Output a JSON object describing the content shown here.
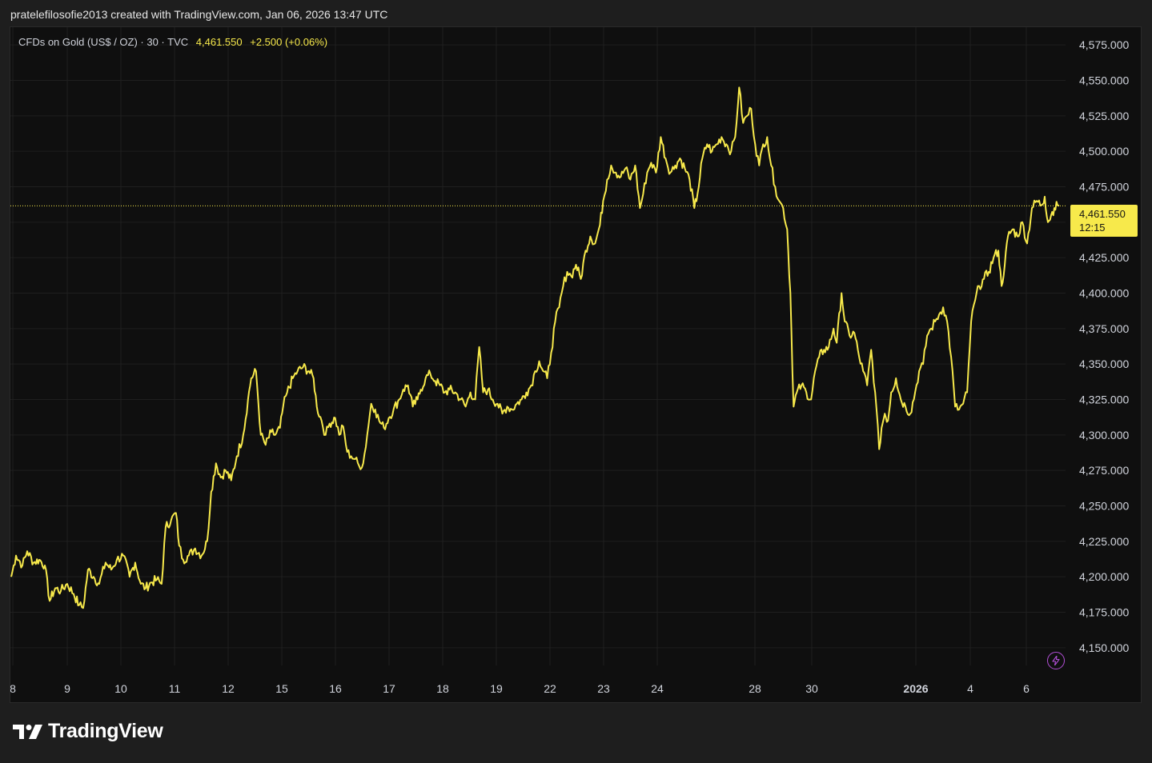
{
  "header": {
    "text": "pratelefilosofie2013 created with TradingView.com, Jan 06, 2026 13:47 UTC"
  },
  "legend": {
    "symbol": "CFDs on Gold (US$ / OZ) · 30 · TVC",
    "last": "4,461.550",
    "change": "+2.500 (+0.06%)"
  },
  "price_tag": {
    "price": "4,461.550",
    "countdown": "12:15"
  },
  "footer": {
    "logo_text": "TradingView"
  },
  "icons": {
    "realtime": "lightning-icon",
    "logo": "tradingview-logo-icon"
  },
  "colors": {
    "line": "#f7e94b",
    "background": "#0f0f0f",
    "grid": "#1f1f1f",
    "accent_purple": "#b24fd6"
  },
  "chart_data": {
    "type": "line",
    "title": "CFDs on Gold (US$ / OZ) · 30 · TVC",
    "ylim": [
      4137.5,
      4587.5
    ],
    "y_ticks": [
      4575,
      4550,
      4525,
      4500,
      4475,
      4450,
      4425,
      4400,
      4375,
      4350,
      4325,
      4300,
      4275,
      4250,
      4225,
      4200,
      4175,
      4150
    ],
    "y_tick_labels": [
      "4,575.000",
      "4,550.000",
      "4,525.000",
      "4,500.000",
      "4,475.000",
      "4,450.000",
      "4,425.000",
      "4,400.000",
      "4,375.000",
      "4,350.000",
      "4,325.000",
      "4,300.000",
      "4,275.000",
      "4,250.000",
      "4,225.000",
      "4,200.000",
      "4,175.000",
      "4,150.000"
    ],
    "x_tick_labels": [
      "8",
      "9",
      "10",
      "11",
      "12",
      "15",
      "16",
      "17",
      "18",
      "19",
      "22",
      "23",
      "24",
      "28",
      "30",
      "2026",
      "4",
      "6"
    ],
    "x_tick_bold": [
      "2026"
    ],
    "last_value": 4461.55,
    "grid": true,
    "series": [
      {
        "x_index_range": [
          0,
          1310
        ],
        "values": [
          [
            0,
            4200
          ],
          [
            6,
            4215
          ],
          [
            14,
            4208
          ],
          [
            20,
            4218
          ],
          [
            28,
            4210
          ],
          [
            35,
            4212
          ],
          [
            42,
            4208
          ],
          [
            48,
            4183
          ],
          [
            55,
            4192
          ],
          [
            62,
            4190
          ],
          [
            70,
            4195
          ],
          [
            78,
            4188
          ],
          [
            85,
            4180
          ],
          [
            90,
            4178
          ],
          [
            96,
            4205
          ],
          [
            103,
            4200
          ],
          [
            110,
            4195
          ],
          [
            118,
            4210
          ],
          [
            125,
            4205
          ],
          [
            132,
            4212
          ],
          [
            140,
            4215
          ],
          [
            148,
            4200
          ],
          [
            155,
            4210
          ],
          [
            162,
            4195
          ],
          [
            168,
            4192
          ],
          [
            175,
            4196
          ],
          [
            182,
            4198
          ],
          [
            188,
            4195
          ],
          [
            193,
            4235
          ],
          [
            200,
            4240
          ],
          [
            206,
            4245
          ],
          [
            210,
            4222
          ],
          [
            215,
            4212
          ],
          [
            222,
            4215
          ],
          [
            230,
            4220
          ],
          [
            238,
            4215
          ],
          [
            245,
            4225
          ],
          [
            250,
            4260
          ],
          [
            256,
            4280
          ],
          [
            262,
            4270
          ],
          [
            268,
            4275
          ],
          [
            275,
            4268
          ],
          [
            282,
            4285
          ],
          [
            290,
            4300
          ],
          [
            296,
            4325
          ],
          [
            300,
            4340
          ],
          [
            306,
            4345
          ],
          [
            312,
            4300
          ],
          [
            318,
            4293
          ],
          [
            325,
            4302
          ],
          [
            330,
            4300
          ],
          [
            336,
            4305
          ],
          [
            340,
            4320
          ],
          [
            345,
            4330
          ],
          [
            352,
            4340
          ],
          [
            358,
            4345
          ],
          [
            365,
            4348
          ],
          [
            372,
            4345
          ],
          [
            378,
            4340
          ],
          [
            382,
            4320
          ],
          [
            388,
            4310
          ],
          [
            393,
            4300
          ],
          [
            398,
            4308
          ],
          [
            405,
            4312
          ],
          [
            410,
            4300
          ],
          [
            415,
            4306
          ],
          [
            420,
            4288
          ],
          [
            425,
            4285
          ],
          [
            430,
            4283
          ],
          [
            435,
            4278
          ],
          [
            440,
            4280
          ],
          [
            445,
            4300
          ],
          [
            450,
            4322
          ],
          [
            455,
            4318
          ],
          [
            460,
            4310
          ],
          [
            466,
            4305
          ],
          [
            472,
            4312
          ],
          [
            478,
            4318
          ],
          [
            485,
            4325
          ],
          [
            490,
            4332
          ],
          [
            496,
            4335
          ],
          [
            502,
            4320
          ],
          [
            508,
            4325
          ],
          [
            512,
            4332
          ],
          [
            518,
            4340
          ],
          [
            524,
            4343
          ],
          [
            530,
            4338
          ],
          [
            536,
            4335
          ],
          [
            542,
            4330
          ],
          [
            548,
            4332
          ],
          [
            555,
            4330
          ],
          [
            562,
            4325
          ],
          [
            568,
            4320
          ],
          [
            574,
            4330
          ],
          [
            580,
            4325
          ],
          [
            585,
            4362
          ],
          [
            590,
            4330
          ],
          [
            596,
            4332
          ],
          [
            602,
            4325
          ],
          [
            608,
            4322
          ],
          [
            614,
            4315
          ],
          [
            620,
            4320
          ],
          [
            626,
            4318
          ],
          [
            632,
            4322
          ],
          [
            638,
            4325
          ],
          [
            644,
            4330
          ],
          [
            650,
            4335
          ],
          [
            655,
            4345
          ],
          [
            660,
            4352
          ],
          [
            665,
            4345
          ],
          [
            670,
            4340
          ],
          [
            675,
            4358
          ],
          [
            680,
            4380
          ],
          [
            685,
            4390
          ],
          [
            690,
            4405
          ],
          [
            695,
            4415
          ],
          [
            700,
            4412
          ],
          [
            706,
            4420
          ],
          [
            712,
            4410
          ],
          [
            718,
            4430
          ],
          [
            724,
            4440
          ],
          [
            730,
            4435
          ],
          [
            736,
            4448
          ],
          [
            740,
            4465
          ],
          [
            745,
            4480
          ],
          [
            750,
            4490
          ],
          [
            756,
            4485
          ],
          [
            762,
            4482
          ],
          [
            768,
            4488
          ],
          [
            774,
            4480
          ],
          [
            780,
            4490
          ],
          [
            786,
            4460
          ],
          [
            790,
            4470
          ],
          [
            795,
            4485
          ],
          [
            800,
            4492
          ],
          [
            806,
            4485
          ],
          [
            812,
            4510
          ],
          [
            818,
            4495
          ],
          [
            824,
            4485
          ],
          [
            830,
            4490
          ],
          [
            836,
            4495
          ],
          [
            842,
            4488
          ],
          [
            848,
            4480
          ],
          [
            854,
            4460
          ],
          [
            858,
            4470
          ],
          [
            864,
            4495
          ],
          [
            870,
            4505
          ],
          [
            876,
            4500
          ],
          [
            882,
            4505
          ],
          [
            888,
            4510
          ],
          [
            894,
            4505
          ],
          [
            900,
            4500
          ],
          [
            905,
            4510
          ],
          [
            910,
            4545
          ],
          [
            915,
            4520
          ],
          [
            920,
            4525
          ],
          [
            925,
            4530
          ],
          [
            930,
            4505
          ],
          [
            935,
            4490
          ],
          [
            940,
            4505
          ],
          [
            945,
            4510
          ],
          [
            950,
            4490
          ],
          [
            955,
            4475
          ],
          [
            960,
            4465
          ],
          [
            965,
            4460
          ],
          [
            970,
            4445
          ],
          [
            974,
            4400
          ],
          [
            978,
            4320
          ],
          [
            982,
            4330
          ],
          [
            988,
            4335
          ],
          [
            994,
            4330
          ],
          [
            1000,
            4325
          ],
          [
            1005,
            4345
          ],
          [
            1010,
            4355
          ],
          [
            1016,
            4360
          ],
          [
            1022,
            4362
          ],
          [
            1028,
            4375
          ],
          [
            1032,
            4365
          ],
          [
            1038,
            4400
          ],
          [
            1042,
            4380
          ],
          [
            1048,
            4370
          ],
          [
            1054,
            4372
          ],
          [
            1060,
            4355
          ],
          [
            1065,
            4345
          ],
          [
            1070,
            4335
          ],
          [
            1075,
            4360
          ],
          [
            1080,
            4330
          ],
          [
            1085,
            4290
          ],
          [
            1088,
            4305
          ],
          [
            1092,
            4315
          ],
          [
            1096,
            4310
          ],
          [
            1100,
            4330
          ],
          [
            1106,
            4340
          ],
          [
            1112,
            4325
          ],
          [
            1118,
            4320
          ],
          [
            1124,
            4315
          ],
          [
            1130,
            4330
          ],
          [
            1135,
            4345
          ],
          [
            1140,
            4350
          ],
          [
            1145,
            4370
          ],
          [
            1150,
            4375
          ],
          [
            1155,
            4380
          ],
          [
            1160,
            4385
          ],
          [
            1165,
            4390
          ],
          [
            1170,
            4380
          ],
          [
            1175,
            4355
          ],
          [
            1180,
            4320
          ],
          [
            1185,
            4318
          ],
          [
            1190,
            4322
          ],
          [
            1195,
            4330
          ],
          [
            1200,
            4380
          ],
          [
            1205,
            4395
          ],
          [
            1210,
            4405
          ],
          [
            1216,
            4410
          ],
          [
            1222,
            4415
          ],
          [
            1228,
            4425
          ],
          [
            1234,
            4430
          ],
          [
            1238,
            4405
          ],
          [
            1242,
            4420
          ],
          [
            1246,
            4440
          ],
          [
            1252,
            4445
          ],
          [
            1258,
            4440
          ],
          [
            1264,
            4450
          ],
          [
            1270,
            4435
          ],
          [
            1276,
            4460
          ],
          [
            1282,
            4465
          ],
          [
            1288,
            4462
          ],
          [
            1292,
            4468
          ],
          [
            1296,
            4450
          ],
          [
            1300,
            4455
          ],
          [
            1304,
            4460
          ],
          [
            1308,
            4462
          ],
          [
            1310,
            4461.55
          ]
        ]
      }
    ]
  }
}
